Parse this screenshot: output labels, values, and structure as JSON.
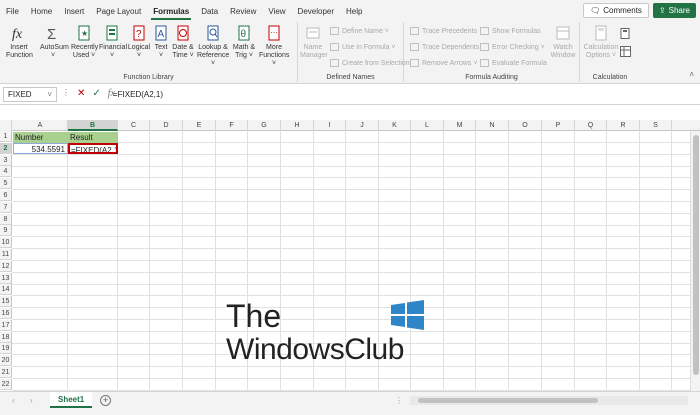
{
  "menu": {
    "tabs": [
      "File",
      "Home",
      "Insert",
      "Page Layout",
      "Formulas",
      "Data",
      "Review",
      "View",
      "Developer",
      "Help"
    ],
    "active_tab": "Formulas",
    "comments_label": "Comments",
    "share_label": "Share"
  },
  "ribbon": {
    "function_library": {
      "label": "Function Library",
      "buttons": [
        {
          "line1": "Insert",
          "line2": "Function"
        },
        {
          "line1": "AutoSum",
          "line2": "˅"
        },
        {
          "line1": "Recently",
          "line2": "Used ˅"
        },
        {
          "line1": "Financial",
          "line2": "˅"
        },
        {
          "line1": "Logical",
          "line2": "˅"
        },
        {
          "line1": "Text",
          "line2": "˅"
        },
        {
          "line1": "Date &",
          "line2": "Time ˅"
        },
        {
          "line1": "Lookup &",
          "line2": "Reference ˅"
        },
        {
          "line1": "Math &",
          "line2": "Trig ˅"
        },
        {
          "line1": "More",
          "line2": "Functions ˅"
        }
      ]
    },
    "defined_names": {
      "label": "Defined Names",
      "name_manager": {
        "line1": "Name",
        "line2": "Manager"
      },
      "items": [
        "Define Name ˅",
        "Use in Formula ˅",
        "Create from Selection"
      ]
    },
    "formula_auditing": {
      "label": "Formula Auditing",
      "left_items": [
        "Trace Precedents",
        "Trace Dependents",
        "Remove Arrows ˅"
      ],
      "right_items": [
        "Show Formulas",
        "Error Checking ˅",
        "Evaluate Formula"
      ],
      "watch_window": {
        "line1": "Watch",
        "line2": "Window"
      }
    },
    "calculation": {
      "label": "Calculation",
      "options": {
        "line1": "Calculation",
        "line2": "Options ˅"
      }
    }
  },
  "formula_bar": {
    "name_box": "FIXED",
    "formula": "=FIXED(A2,1)"
  },
  "grid": {
    "columns": [
      "A",
      "B",
      "C",
      "D",
      "E",
      "F",
      "G",
      "H",
      "I",
      "J",
      "K",
      "L",
      "M",
      "N",
      "O",
      "P",
      "Q",
      "R",
      "S"
    ],
    "rows": [
      "1",
      "2",
      "3",
      "4",
      "5",
      "6",
      "7",
      "8",
      "9",
      "10",
      "11",
      "12",
      "13",
      "14",
      "15",
      "16",
      "17",
      "18",
      "19",
      "20",
      "21",
      "22"
    ],
    "cells": {
      "A1": "Number",
      "B1": "Result",
      "A2": "534.5591",
      "B2": "=FIXED(A2,1)"
    },
    "header_fill": "#a9d08e",
    "active_border": "#c00000"
  },
  "sheets": {
    "tabs": [
      "Sheet1"
    ],
    "add_symbol": "+"
  },
  "watermark": {
    "line1": "The",
    "line2": "WindowsClub"
  },
  "accent": "#217346"
}
